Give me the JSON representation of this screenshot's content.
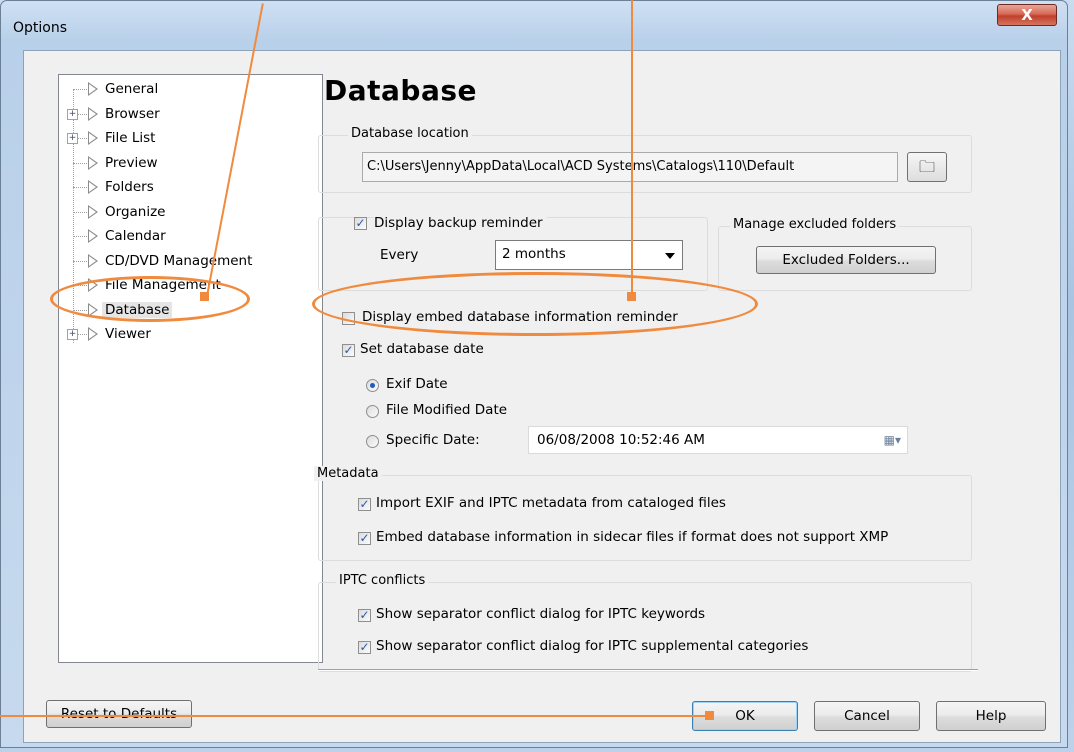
{
  "window": {
    "title": "Options",
    "close_glyph": "X"
  },
  "tree": {
    "items": [
      {
        "label": "General",
        "expandable": false
      },
      {
        "label": "Browser",
        "expandable": true
      },
      {
        "label": "File List",
        "expandable": true
      },
      {
        "label": "Preview",
        "expandable": false
      },
      {
        "label": "Folders",
        "expandable": false
      },
      {
        "label": "Organize",
        "expandable": false
      },
      {
        "label": "Calendar",
        "expandable": false
      },
      {
        "label": "CD/DVD Management",
        "expandable": false
      },
      {
        "label": "File Management",
        "expandable": false
      },
      {
        "label": "Database",
        "expandable": false,
        "selected": true
      },
      {
        "label": "Viewer",
        "expandable": true
      }
    ]
  },
  "page": {
    "heading": "Database",
    "db_location": {
      "group_label": "Database location",
      "path": "C:\\Users\\Jenny\\AppData\\Local\\ACD Systems\\Catalogs\\110\\Default",
      "browse_icon": "folder-browse-icon"
    },
    "backup": {
      "checkbox_label": "Display backup reminder",
      "checked": true,
      "every_label": "Every",
      "every_value": "2 months"
    },
    "excluded": {
      "group_label": "Manage excluded folders",
      "button_label": "Excluded Folders..."
    },
    "embed_reminder": {
      "label": "Display embed database information reminder",
      "checked": false
    },
    "set_date": {
      "label": "Set database date",
      "checked": true,
      "options": [
        "Exif Date",
        "File Modified Date",
        "Specific Date:"
      ],
      "selected": "Exif Date",
      "specific_value": "06/08/2008 10:52:46 AM"
    },
    "metadata": {
      "group_label": "Metadata",
      "items": [
        {
          "label": "Import EXIF and IPTC metadata from cataloged files",
          "checked": true
        },
        {
          "label": "Embed database information in sidecar files if format does not support XMP",
          "checked": true
        }
      ]
    },
    "iptc": {
      "group_label": "IPTC conflicts",
      "items": [
        {
          "label": "Show separator conflict dialog for IPTC keywords",
          "checked": true
        },
        {
          "label": "Show separator conflict dialog for IPTC supplemental categories",
          "checked": true
        }
      ]
    }
  },
  "footer": {
    "reset_label": "Reset to Defaults",
    "ok_label": "OK",
    "cancel_label": "Cancel",
    "help_label": "Help"
  },
  "colors": {
    "annotation": "#f08a3e",
    "close_button": "#c0402b"
  }
}
